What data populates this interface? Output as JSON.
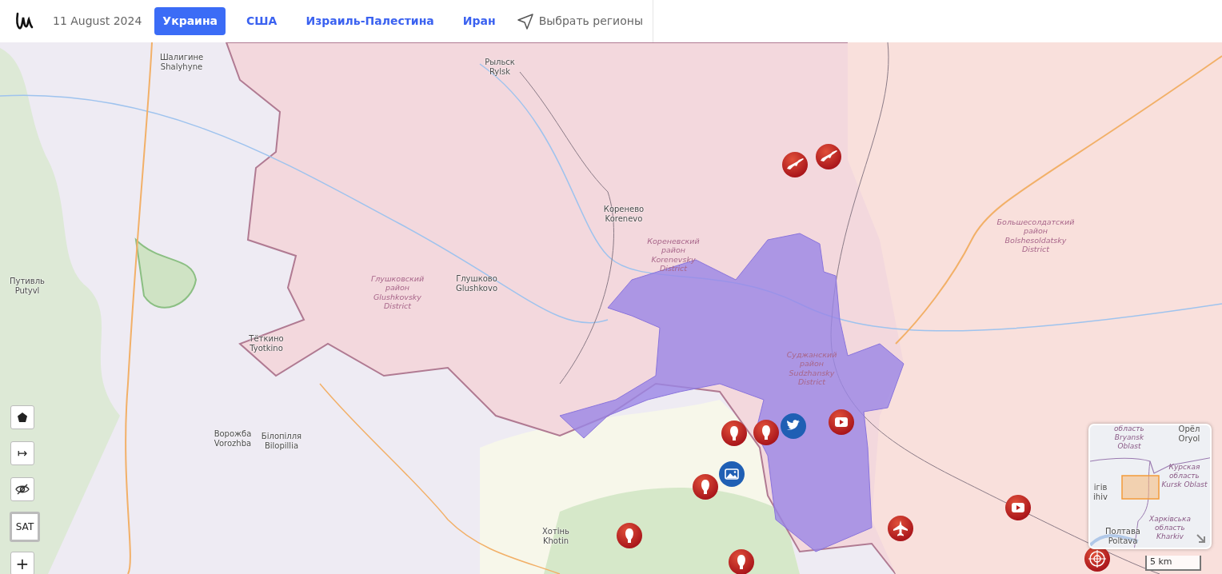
{
  "header": {
    "date": "11 August 2024",
    "tabs": [
      {
        "label": "Украина",
        "selected": true
      },
      {
        "label": "США",
        "selected": false
      },
      {
        "label": "Израиль-Палестина",
        "selected": false
      },
      {
        "label": "Иран",
        "selected": false
      }
    ],
    "region_picker": "Выбрать регионы"
  },
  "map": {
    "labels": [
      {
        "kind": "city",
        "lines": [
          "Шалигине",
          "Shalyhyne"
        ]
      },
      {
        "kind": "city",
        "lines": [
          "Рыльск",
          "Rylsk"
        ]
      },
      {
        "kind": "city",
        "lines": [
          "Коренево",
          "Korenevo"
        ]
      },
      {
        "kind": "district",
        "lines": [
          "Большесолдатский",
          "район",
          "Bolshesoldatsky",
          "District"
        ]
      },
      {
        "kind": "district",
        "lines": [
          "Кореневский",
          "район",
          "Korenevsky",
          "District"
        ]
      },
      {
        "kind": "city",
        "lines": [
          "Путивль",
          "Putyvl"
        ]
      },
      {
        "kind": "district",
        "lines": [
          "Глушковский",
          "район",
          "Glushkovsky",
          "District"
        ]
      },
      {
        "kind": "city",
        "lines": [
          "Глушково",
          "Glushkovo"
        ]
      },
      {
        "kind": "city",
        "lines": [
          "Тёткино",
          "Tyotkino"
        ]
      },
      {
        "kind": "district",
        "lines": [
          "Суджанский",
          "район",
          "Sudzhansky",
          "District"
        ]
      },
      {
        "kind": "city",
        "lines": [
          "Ворожба",
          "Vorozhba"
        ]
      },
      {
        "kind": "city",
        "lines": [
          "Білопілля",
          "Bilopillia"
        ]
      },
      {
        "kind": "city",
        "lines": [
          "Хотінь",
          "Khotin"
        ]
      }
    ],
    "markers": [
      {
        "kind": "rifle"
      },
      {
        "kind": "rifle"
      },
      {
        "kind": "youtube"
      },
      {
        "kind": "twitter"
      },
      {
        "kind": "bomb"
      },
      {
        "kind": "bomb"
      },
      {
        "kind": "photo"
      },
      {
        "kind": "bomb"
      },
      {
        "kind": "youtube"
      },
      {
        "kind": "plane"
      },
      {
        "kind": "bomb"
      },
      {
        "kind": "target"
      },
      {
        "kind": "bomb"
      }
    ]
  },
  "controls": [
    {
      "kind": "draw"
    },
    {
      "kind": "arrow",
      "label": "↦"
    },
    {
      "kind": "hide"
    },
    {
      "kind": "layer",
      "label": "SAT"
    },
    {
      "kind": "zoom",
      "label": "+"
    }
  ],
  "minimap": {
    "labels": [
      {
        "kind": "region",
        "lines": [
          "область",
          "Bryansk",
          "Oblast"
        ]
      },
      {
        "kind": "city",
        "lines": [
          "Орёл",
          "Oryol"
        ]
      },
      {
        "kind": "region",
        "lines": [
          "Курская",
          "область",
          "Kursk Oblast"
        ]
      },
      {
        "kind": "city",
        "lines": [
          "ігів",
          "ihiv"
        ]
      },
      {
        "kind": "city",
        "lines": [
          "Полтава",
          "Poltava"
        ]
      },
      {
        "kind": "region",
        "lines": [
          "Харківська",
          "область",
          "Kharkiv"
        ]
      }
    ]
  },
  "scale": "5 km"
}
